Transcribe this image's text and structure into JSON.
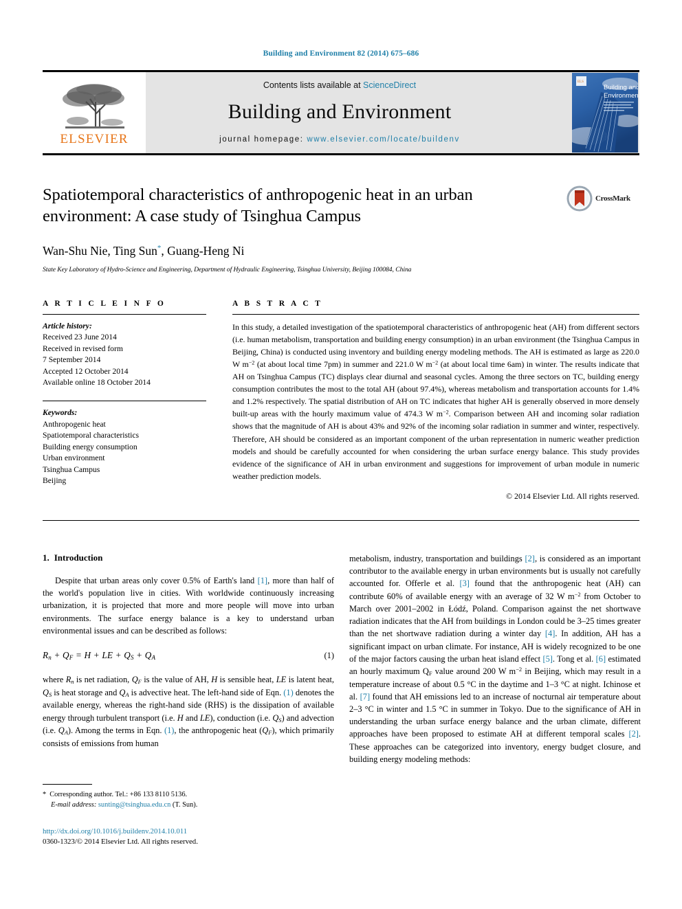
{
  "running_head": "Building and Environment 82 (2014) 675–686",
  "masthead": {
    "contents_prefix": "Contents lists available at ",
    "sciencedirect": "ScienceDirect",
    "journal_title": "Building and Environment",
    "homepage_label": "journal homepage:",
    "homepage_url": "www.elsevier.com/locate/buildenv",
    "publisher_logo_text": "ELSEVIER",
    "cover_title_line1": "Building and",
    "cover_title_line2": "Environment"
  },
  "crossmark": {
    "label": "CrossMark"
  },
  "title": "Spatiotemporal characteristics of anthropogenic heat in an urban environment: A case study of Tsinghua Campus",
  "authors_prefix": "Wan-Shu Nie, Ting Sun",
  "authors_star": "*",
  "authors_suffix": ", Guang-Heng Ni",
  "affiliation": "State Key Laboratory of Hydro-Science and Engineering, Department of Hydraulic Engineering, Tsinghua University, Beijing 100084, China",
  "article_info": {
    "heading": "A R T I C L E   I N F O",
    "history_label": "Article history:",
    "history": [
      "Received 23 June 2014",
      "Received in revised form",
      "7 September 2014",
      "Accepted 12 October 2014",
      "Available online 18 October 2014"
    ],
    "keywords_label": "Keywords:",
    "keywords": [
      "Anthropogenic heat",
      "Spatiotemporal characteristics",
      "Building energy consumption",
      "Urban environment",
      "Tsinghua Campus",
      "Beijing"
    ]
  },
  "abstract": {
    "heading": "A B S T R A C T",
    "part1": "In this study, a detailed investigation of the spatiotemporal characteristics of anthropogenic heat (AH) from different sectors (i.e. human metabolism, transportation and building energy consumption) in an urban environment (the Tsinghua Campus in Beijing, China) is conducted using inventory and building energy modeling methods. The AH is estimated as large as 220.0 W m",
    "sup1": "−2",
    "part2": " (at about local time 7pm) in summer and 221.0 W m",
    "sup2": "−2",
    "part3": " (at about local time 6am) in winter. The results indicate that AH on Tsinghua Campus (TC) displays clear diurnal and seasonal cycles. Among the three sectors on TC, building energy consumption contributes the most to the total AH (about 97.4%), whereas metabolism and transportation accounts for 1.4% and 1.2% respectively. The spatial distribution of AH on TC indicates that higher AH is generally observed in more densely built-up areas with the hourly maximum value of 474.3 W m",
    "sup3": "−2",
    "part4": ". Comparison between AH and incoming solar radiation shows that the magnitude of AH is about 43% and 92% of the incoming solar radiation in summer and winter, respectively. Therefore, AH should be considered as an important component of the urban representation in numeric weather prediction models and should be carefully accounted for when considering the urban surface energy balance. This study provides evidence of the significance of AH in urban environment and suggestions for improvement of urban module in numeric weather prediction models.",
    "copyright": "© 2014 Elsevier Ltd. All rights reserved."
  },
  "introduction": {
    "number": "1.",
    "heading": "Introduction",
    "p1_a": "Despite that urban areas only cover 0.5% of Earth's land ",
    "p1_ref1": "[1]",
    "p1_b": ", more than half of the world's population live in cities. With worldwide continuously increasing urbanization, it is projected that more and more people will move into urban environments. The surface energy balance is a key to understand urban environmental issues and can be described as follows:",
    "equation": "R<sub>n</sub> + Q<sub>F</sub> = H + LE + Q<sub>S</sub> + Q<sub>A</sub>",
    "equation_number": "(1)",
    "p2_a": "where R",
    "p2_text": "where Rn is net radiation, QF is the value of AH, H is sensible heat, LE is latent heat, QS is heat storage and QA is advective heat. The left-hand side of Eqn. (1) denotes the available energy, whereas the right-hand side (RHS) is the dissipation of available energy through turbulent transport (i.e. H and LE), conduction (i.e. QS) and advection (i.e. QA). Among the terms in Eqn. (1), the anthropogenic heat (QF), which primarily consists of emissions from human"
  },
  "right_column": {
    "p_a": "metabolism, industry, transportation and buildings ",
    "ref2a": "[2]",
    "p_b": ", is considered as an important contributor to the available energy in urban environments but is usually not carefully accounted for. Offerle et al. ",
    "ref3": "[3]",
    "p_c": " found that the anthropogenic heat (AH) can contribute 60% of available energy with an average of 32 W m",
    "sup_a": "−2",
    "p_d": " from October to March over 2001–2002 in Łódź, Poland. Comparison against the net shortwave radiation indicates that the AH from buildings in London could be 3–25 times greater than the net shortwave radiation during a winter day ",
    "ref4": "[4]",
    "p_e": ". In addition, AH has a significant impact on urban climate. For instance, AH is widely recognized to be one of the major factors causing the urban heat island effect ",
    "ref5": "[5]",
    "p_f": ". Tong et al. ",
    "ref6": "[6]",
    "p_g": " estimated an hourly maximum Q",
    "subF": "F",
    "p_h": " value around 200 W m",
    "sup_b": "−2",
    "p_i": " in Beijing, which may result in a temperature increase of about 0.5 °C in the daytime and 1–3 °C at night. Ichinose et al. ",
    "ref7": "[7]",
    "p_j": " found that AH emissions led to an increase of nocturnal air temperature about 2–3 °C in winter and 1.5 °C in summer in Tokyo. Due to the significance of AH in understanding the urban surface energy balance and the urban climate, different approaches have been proposed to estimate AH at different temporal scales ",
    "ref2b": "[2]",
    "p_k": ". These approaches can be categorized into inventory, energy budget closure, and building energy modeling methods:"
  },
  "footnote": {
    "star": "*",
    "corresponding": "Corresponding author. Tel.: +86 133 8110 5136.",
    "email_label": "E-mail address:",
    "email": "sunting@tsinghua.edu.cn",
    "email_suffix": " (T. Sun)."
  },
  "footer": {
    "doi": "http://dx.doi.org/10.1016/j.buildenv.2014.10.011",
    "issn": "0360-1323/© 2014 Elsevier Ltd. All rights reserved."
  },
  "colors": {
    "link": "#1f7fa8",
    "elsevier_orange": "#e77518",
    "masthead_bg": "#e4e4e4"
  }
}
